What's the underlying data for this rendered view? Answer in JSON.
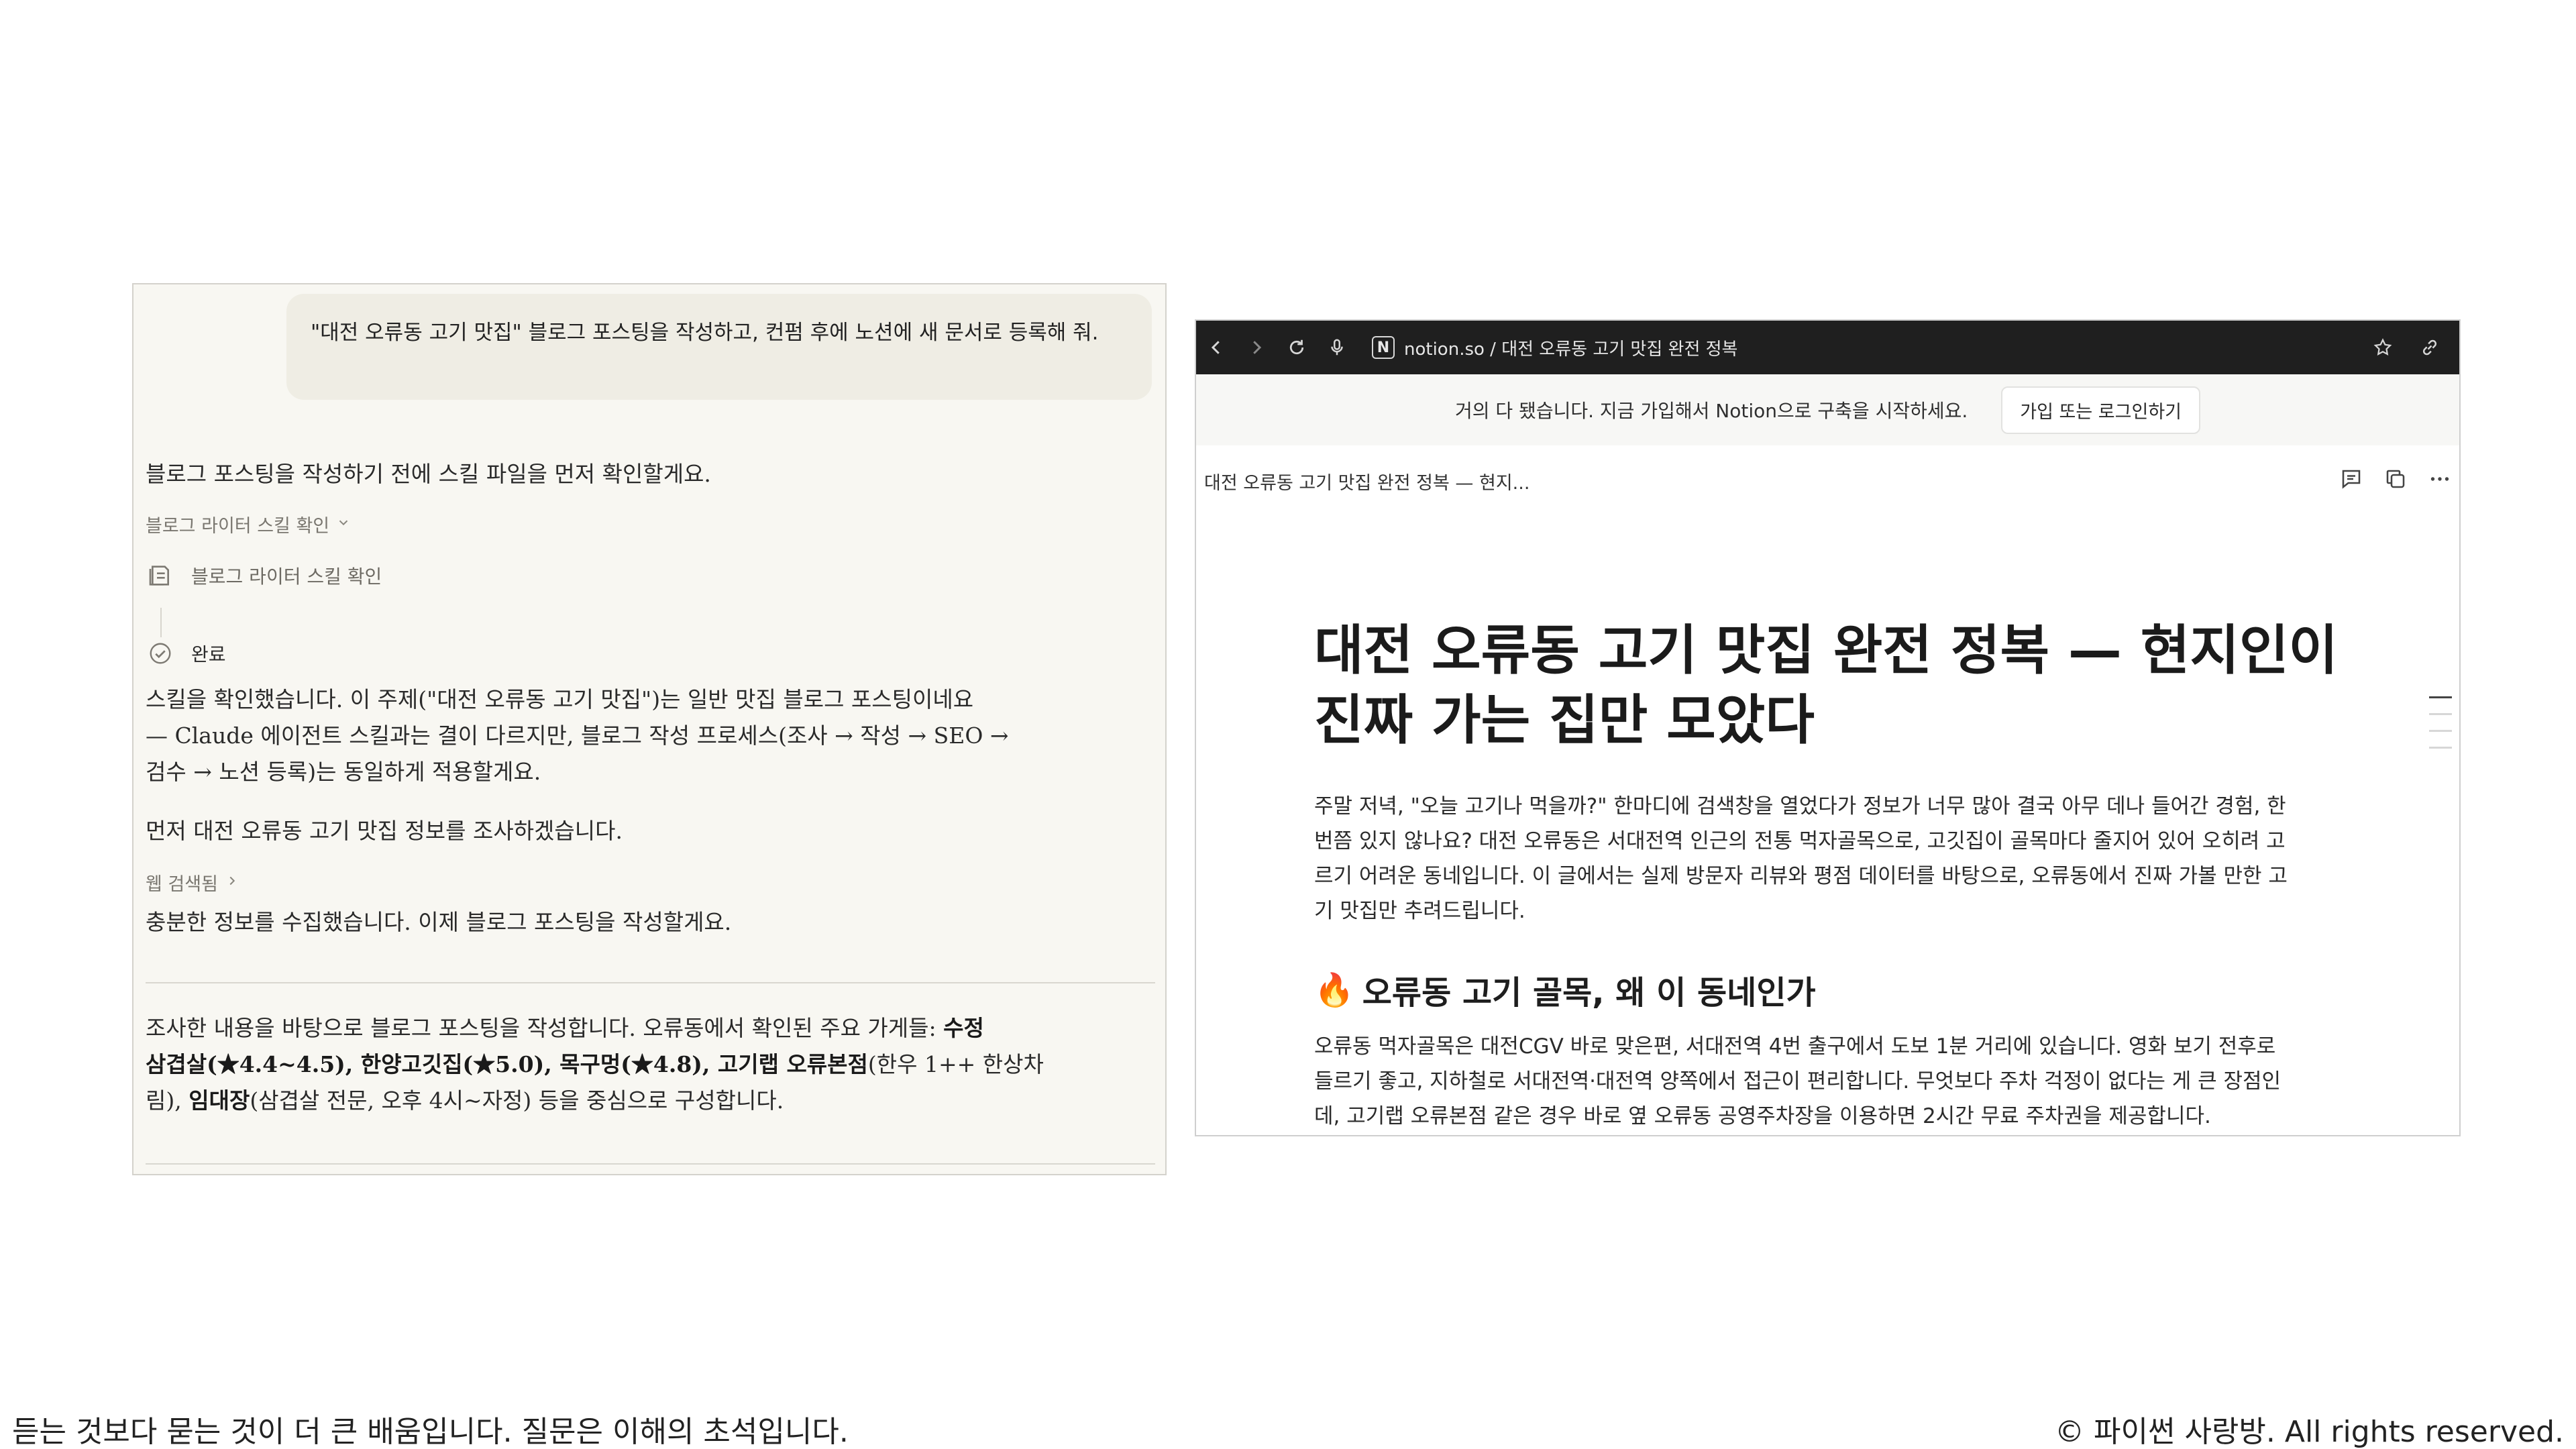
{
  "chat": {
    "user_message": "\"대전 오류동 고기 맛집\" 블로그 포스팅을 작성하고, 컨펌 후에 노션에 새 문서로 등록해 줘.",
    "intro": "블로그 포스팅을 작성하기 전에 스킬 파일을 먼저 확인할게요.",
    "skill_check_toggle": "블로그 라이터 스킬 확인",
    "step_label": "블로그 라이터 스킬 확인",
    "step_done": "완료",
    "para1_line1": "스킬을 확인했습니다. 이 주제(\"대전 오류동 고기 맛집\")는 일반 맛집 블로그 포스팅이네요",
    "para1_line2": "— Claude 에이전트 스킬과는 결이 다르지만, 블로그 작성 프로세스(조사 → 작성 → SEO →",
    "para1_line3": "검수 → 노션 등록)는 동일하게 적용할게요.",
    "para2": "먼저 대전 오류동 고기 맛집 정보를 조사하겠습니다.",
    "web_search": "웹 검색됨",
    "para3": "충분한 정보를 수집했습니다. 이제 블로그 포스팅을 작성할게요.",
    "para4_a": "조사한 내용을 바탕으로 블로그 포스팅을 작성합니다. 오류동에서 확인된 주요 가게들:",
    "para4_b1": "수정",
    "para4_b2": "삼겹살(★4.4~4.5), 한양고깃집(★5.0), 목구멍(★4.8), 고기랩 오류본점",
    "para4_c": "(한우 1++ 한상차",
    "para4_d": "림),",
    "para4_e": "임대장",
    "para4_f": "(삼겹살 전문, 오후 4시~자정) 등을 중심으로 구성합니다."
  },
  "browser": {
    "url": "notion.so / 대전 오류동 고기 맛집 완전 정복",
    "banner_text": "거의 다 됐습니다. 지금 가입해서 Notion으로 구축을 시작하세요.",
    "banner_button": "가입 또는 로그인하기",
    "page_header_title": "대전 오류동 고기 맛집 완전 정복 — 현지...",
    "doc_title_line1": "대전 오류동 고기 맛집 완전 정복 — 현지인이",
    "doc_title_line2": "진짜 가는 집만 모았다",
    "intro_line1": "주말 저녁, \"오늘 고기나 먹을까?\" 한마디에 검색창을 열었다가 정보가 너무 많아 결국 아무 데나 들어간 경험, 한",
    "intro_line2": "번쯤 있지 않나요? 대전 오류동은 서대전역 인근의 전통 먹자골목으로, 고깃집이 골목마다 줄지어 있어 오히려 고",
    "intro_line3": "르기 어려운 동네입니다. 이 글에서는 실제 방문자 리뷰와 평점 데이터를 바탕으로, 오류동에서 진짜 가볼 만한 고",
    "intro_line4": "기 맛집만 추려드립니다.",
    "section_emoji": "🔥",
    "section_title": "오류동 고기 골목, 왜 이 동네인가",
    "section_line1": "오류동 먹자골목은 대전CGV 바로 맞은편, 서대전역 4번 출구에서 도보 1분 거리에 있습니다. 영화 보기 전후로",
    "section_line2": "들르기 좋고, 지하철로 서대전역·대전역 양쪽에서 접근이 편리합니다. 무엇보다 주차 걱정이 없다는 게 큰 장점인",
    "section_line3": "데, 고기랩 오류본점 같은 경우 바로 옆 오류동 공영주차장을 이용하면 2시간 무료 주차권을 제공합니다."
  },
  "footer": {
    "left": "듣는 것보다 묻는 것이 더 큰 배움입니다. 질문은 이해의 초석입니다.",
    "right": "© 파이썬 사랑방. All rights reserved."
  }
}
